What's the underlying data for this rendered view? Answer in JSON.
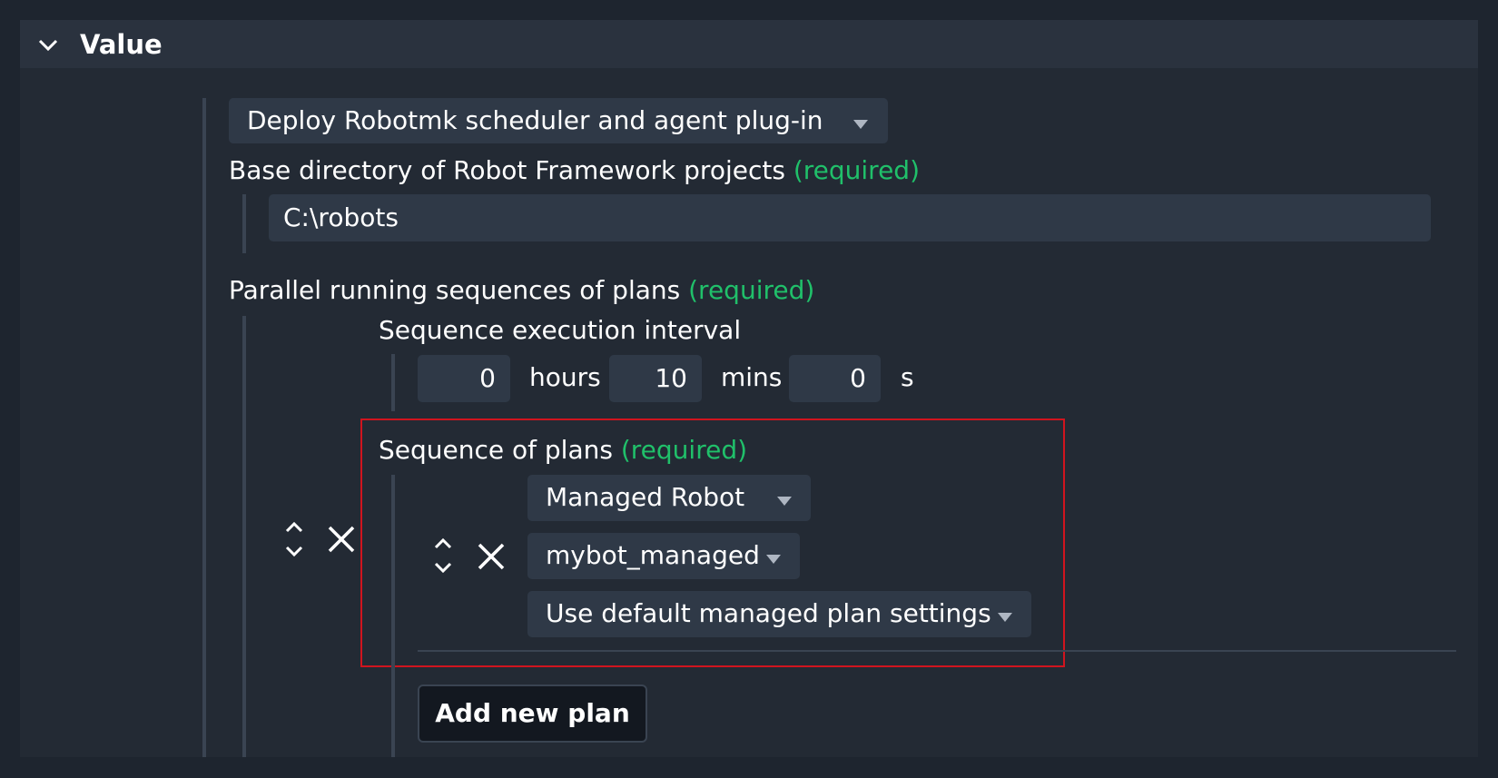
{
  "header": {
    "title": "Value",
    "collapse_icon": "chevron-down-icon"
  },
  "deploy_select": {
    "value": "Deploy Robotmk scheduler and agent plug-in"
  },
  "base_dir": {
    "label": "Base directory of Robot Framework projects",
    "required": "(required)",
    "value": "C:\\robots"
  },
  "parallel": {
    "label": "Parallel running sequences of plans",
    "required": "(required)"
  },
  "interval": {
    "label": "Sequence execution interval",
    "hours_value": "0",
    "hours_unit": "hours",
    "mins_value": "10",
    "mins_unit": "mins",
    "secs_value": "0",
    "secs_unit": "s"
  },
  "sequence": {
    "label": "Sequence of plans",
    "required": "(required)",
    "plan_type": "Managed Robot",
    "plan_name": "mybot_managed",
    "plan_settings": "Use default managed plan settings",
    "add_button": "Add new plan"
  },
  "colors": {
    "required": "#20c06a",
    "highlight": "#d0141e",
    "background": "#1e252f"
  }
}
